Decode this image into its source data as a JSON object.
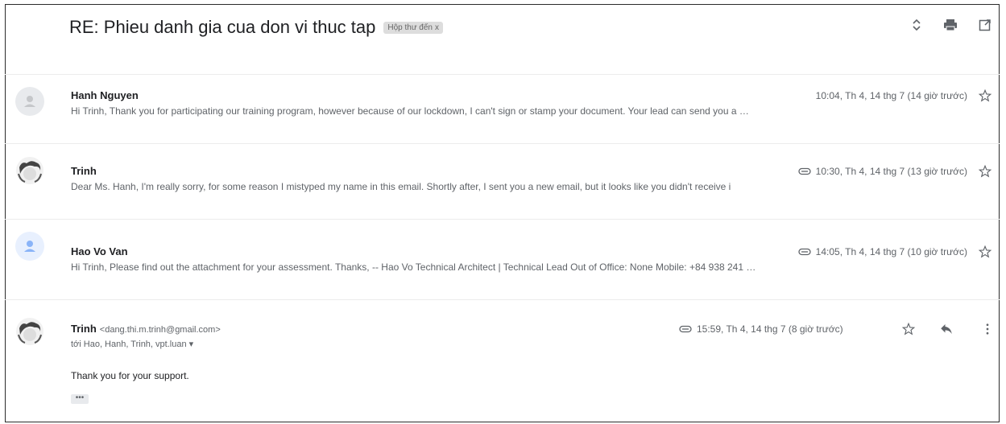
{
  "thread": {
    "subject": "RE: Phieu danh gia cua don vi thuc tap",
    "label": "Hộp thư đến",
    "label_close": "x"
  },
  "messages": [
    {
      "sender": "Hanh Nguyen",
      "date": "10:04, Th 4, 14 thg 7 (14 giờ trước)",
      "snippet": "Hi Trinh, Thank you for participating our training program, however because of our lockdown, I can't sign or stamp your document. Your lead can send you a …",
      "has_attachment": false
    },
    {
      "sender": "Trinh",
      "date": "10:30, Th 4, 14 thg 7 (13 giờ trước)",
      "snippet": "Dear Ms. Hanh, I'm really sorry, for some reason I mistyped my name in this email. Shortly after, I sent you a new email, but it looks like you didn't receive i",
      "has_attachment": true
    },
    {
      "sender": "Hao Vo Van",
      "date": "14:05, Th 4, 14 thg 7 (10 giờ trước)",
      "snippet": "Hi Trinh, Please find out the attachment for your assessment. Thanks, -- Hao Vo Technical Architect | Technical Lead Out of Office: None Mobile: +84 938 241 …",
      "has_attachment": true
    }
  ],
  "expanded": {
    "sender": "Trinh",
    "email": "<dang.thi.m.trinh@gmail.com>",
    "recipients": "tới Hao, Hanh, Trinh, vpt.luan ▾",
    "date": "15:59, Th 4, 14 thg 7 (8 giờ trước)",
    "body": "Thank you for your support.",
    "trimmed": "•••"
  },
  "colors": {
    "accent_blue": "#4285f4",
    "icon_gray": "#5f6368"
  }
}
